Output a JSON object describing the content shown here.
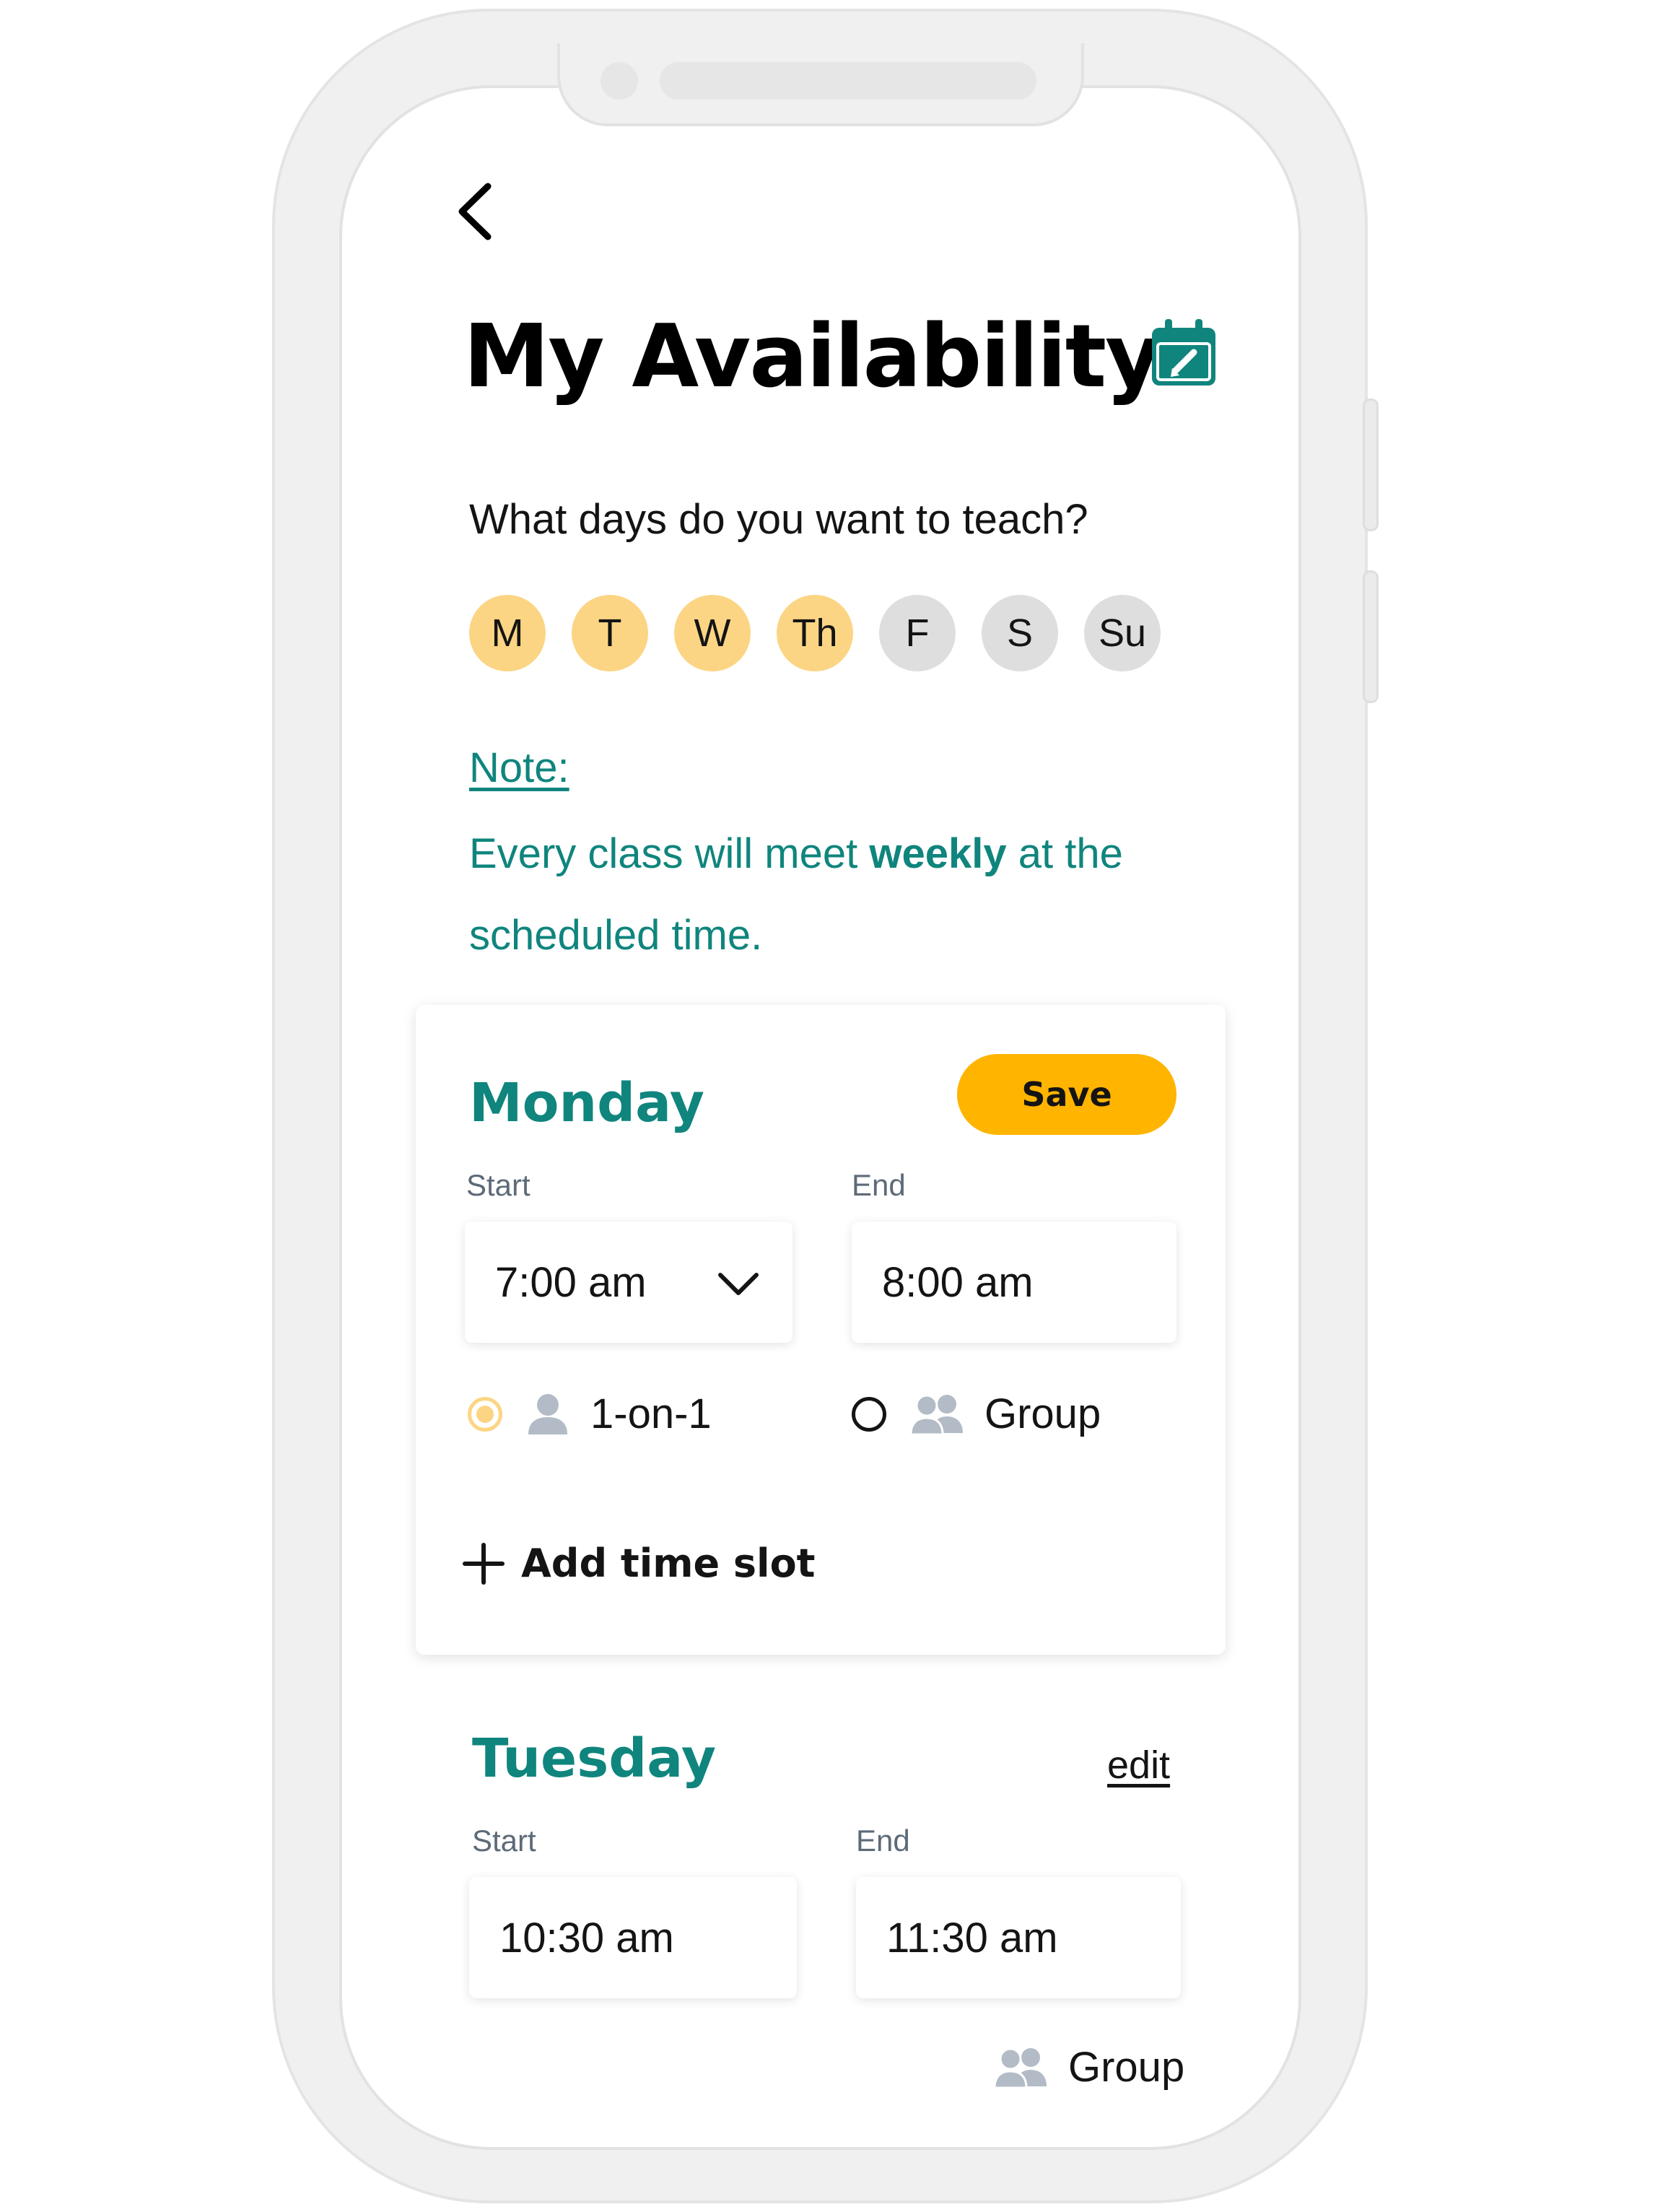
{
  "header": {
    "back_icon": "chevron-left-icon",
    "title": "My Availability",
    "calendar_icon": "calendar-edit-icon"
  },
  "days_prompt": "What days do you want to teach?",
  "days": [
    {
      "label": "M",
      "selected": true
    },
    {
      "label": "T",
      "selected": true
    },
    {
      "label": "W",
      "selected": true
    },
    {
      "label": "Th",
      "selected": true
    },
    {
      "label": "F",
      "selected": false
    },
    {
      "label": "S",
      "selected": false
    },
    {
      "label": "Su",
      "selected": false
    }
  ],
  "note": {
    "label": "Note:",
    "text_before": "Every class will meet ",
    "text_bold": "weekly",
    "text_after": " at the scheduled time."
  },
  "monday": {
    "title": "Monday",
    "save_label": "Save",
    "start_label": "Start",
    "start_value": "7:00 am",
    "end_label": "End",
    "end_value": "8:00 am",
    "option_one": "1-on-1",
    "option_group": "Group",
    "selected_option": "1-on-1",
    "add_slot_label": "Add time slot"
  },
  "tuesday": {
    "title": "Tuesday",
    "edit_label": "edit",
    "start_label": "Start",
    "start_value": "10:30 am",
    "end_label": "End",
    "end_value": "11:30 am",
    "session_type": "Group"
  },
  "colors": {
    "accent_teal": "#0f857d",
    "selected_day": "#fcd584",
    "unselected_day": "#dedede",
    "save_button": "#ffb400",
    "icon_gray": "#b3bcc6"
  }
}
